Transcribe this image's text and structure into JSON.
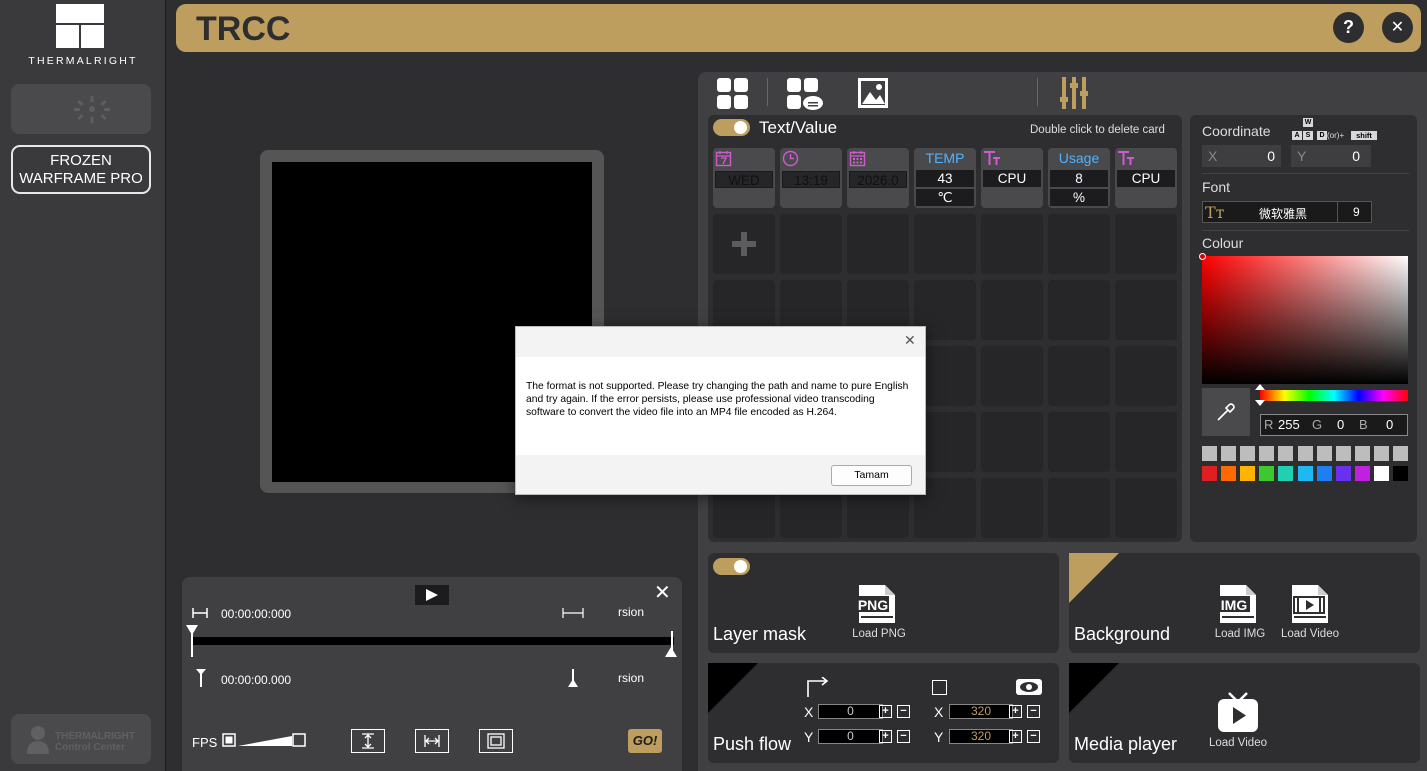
{
  "app": {
    "title": "TRCC",
    "brand": "THERMALRIGHT"
  },
  "titlebar": {
    "help_label": "?",
    "close_label": "✕"
  },
  "sidebar": {
    "device_button": "",
    "product_line1": "FROZEN",
    "product_line2": "WARFRAME PRO",
    "control_center_line1": "THERMALRIGHT",
    "control_center_line2": "Control Center"
  },
  "player": {
    "time_top": "00:00:00:000",
    "time_bottom": "00:00:00.000",
    "version_top": "rsion",
    "version_bottom": "rsion",
    "fps_label": "FPS",
    "go_label": "GO!",
    "close_label": "✕"
  },
  "editor": {
    "section_title": "Text/Value",
    "hint": "Double click to delete card",
    "cards": [
      {
        "icon": "calendar-icon",
        "title": "",
        "value": "WED",
        "unit": "",
        "color": "#d05ad0"
      },
      {
        "icon": "clock-icon",
        "title": "",
        "value": "13:19",
        "unit": "",
        "color": "#d05ad0"
      },
      {
        "icon": "calendar-grid-icon",
        "title": "",
        "value": "2026.0",
        "unit": "",
        "color": "#d05ad0"
      },
      {
        "icon": "",
        "title": "TEMP",
        "value": "43",
        "unit": "℃",
        "color": "#4fb3ff"
      },
      {
        "icon": "font-icon",
        "title": "",
        "value": "CPU",
        "unit": "",
        "color": "#d05ad0"
      },
      {
        "icon": "",
        "title": "Usage",
        "value": "8",
        "unit": "%",
        "color": "#4fb3ff"
      },
      {
        "icon": "font-icon",
        "title": "",
        "value": "CPU",
        "unit": "",
        "color": "#d05ad0"
      }
    ],
    "add_label": "+"
  },
  "props": {
    "coordinate_label": "Coordinate",
    "keys": {
      "w": "W",
      "a": "A",
      "s": "S",
      "d": "D",
      "or": "(or)+",
      "shift": "shift"
    },
    "x_label": "X",
    "x_value": "0",
    "y_label": "Y",
    "y_value": "0",
    "font_label": "Font",
    "font_name": "微软雅黑",
    "font_size": "9",
    "colour_label": "Colour",
    "r_label": "R",
    "r_value": "255",
    "g_label": "G",
    "g_value": "0",
    "b_label": "B",
    "b_value": "0",
    "swatches_row2": [
      "#e02020",
      "#ff6a00",
      "#ffb400",
      "#3cc830",
      "#20d0b0",
      "#20b8f0",
      "#1e7ff0",
      "#6a30f0",
      "#c020e0",
      "#ffffff",
      "#000000"
    ],
    "accent": "#bd9e5e"
  },
  "panels": {
    "layer_mask": {
      "title": "Layer mask",
      "button_label": "Load PNG",
      "icon_text": "PNG"
    },
    "background": {
      "title": "Background",
      "img_label": "Load IMG",
      "img_icon_text": "IMG",
      "video_label": "Load Video"
    },
    "push_flow": {
      "title": "Push flow",
      "pos_x_label": "X",
      "pos_x": "0",
      "pos_y_label": "Y",
      "pos_y": "0",
      "size_x_label": "X",
      "size_x": "320",
      "size_y_label": "Y",
      "size_y": "320"
    },
    "media_player": {
      "title": "Media player",
      "button_label": "Load Video"
    }
  },
  "dialog": {
    "close_label": "✕",
    "message": "The format is not supported. Please try changing the path and name to pure English and try again. If the error persists, please use professional video transcoding software to convert the video file into an MP4 file encoded as H.264.",
    "ok_label": "Tamam"
  }
}
